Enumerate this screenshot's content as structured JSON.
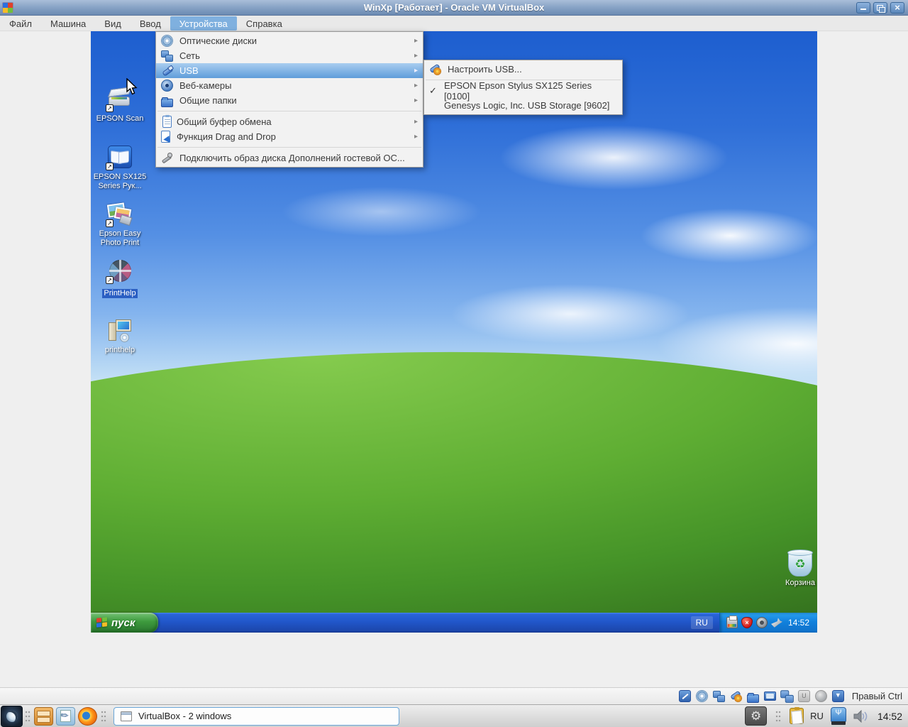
{
  "titlebar": {
    "title": "WinXp [Работает] - Oracle VM VirtualBox"
  },
  "menubar": {
    "items": [
      "Файл",
      "Машина",
      "Вид",
      "Ввод",
      "Устройства",
      "Справка"
    ],
    "active": "Устройства"
  },
  "devices_menu": {
    "items": [
      {
        "label": "Оптические диски",
        "icon": "optical-disc-icon"
      },
      {
        "label": "Сеть",
        "icon": "network-icon"
      },
      {
        "label": "USB",
        "icon": "usb-icon",
        "highlighted": true
      },
      {
        "label": "Веб-камеры",
        "icon": "webcam-icon"
      },
      {
        "label": "Общие папки",
        "icon": "shared-folders-icon"
      },
      {
        "label": "Общий буфер обмена",
        "icon": "clipboard-icon"
      },
      {
        "label": "Функция Drag and Drop",
        "icon": "drag-and-drop-icon"
      },
      {
        "label": "Подключить образ диска Дополнений гостевой ОС...",
        "icon": "guest-additions-icon"
      }
    ]
  },
  "usb_submenu": {
    "settings_label": "Настроить USB...",
    "devices": [
      {
        "label": "EPSON Epson Stylus SX125 Series [0100]",
        "checked": true,
        "check_glyph": "✓"
      },
      {
        "label": "Genesys Logic, Inc. USB Storage [9602]",
        "checked": false,
        "check_glyph": ""
      }
    ]
  },
  "desktop": {
    "icons": [
      {
        "label": "EPSON Scan",
        "icon": "epson-scan-icon"
      },
      {
        "label": "EPSON SX125 Series Рук...",
        "icon": "epson-manual-icon"
      },
      {
        "label": "Epson Easy Photo Print",
        "icon": "epson-photo-print-icon"
      },
      {
        "label": "PrintHelp",
        "icon": "printhelp-wheel-icon",
        "selected": true
      },
      {
        "label": "printhelp",
        "icon": "printhelp-setup-icon"
      }
    ],
    "recycle_bin_label": "Корзина"
  },
  "guest_taskbar": {
    "start_label": "пуск",
    "language": "RU",
    "clock": "14:52",
    "tray_icons": [
      "printer-status-icon",
      "security-alert-shield-icon",
      "speaker-icon",
      "epson-monitor-icon"
    ]
  },
  "vbox_statusbar": {
    "host_key_label": "Правый Ctrl",
    "icons": [
      "hard-disks-icon",
      "optical-drives-icon",
      "network-adapters-icon",
      "usb-devices-icon",
      "shared-folders-icon",
      "display-icon",
      "recording-icon",
      "features-icon",
      "mouse-integration-icon",
      "statusbar-menu-icon"
    ]
  },
  "host_taskbar": {
    "task_button_label": "VirtualBox - 2 windows",
    "language": "RU",
    "clock": "14:52",
    "launcher_icons": [
      "app-menu-icon",
      "file-manager-icon",
      "text-editor-icon",
      "firefox-icon"
    ],
    "tray_icons": [
      "settings-gear-icon",
      "clipboard-manager-icon",
      "usb-drive-icon",
      "volume-icon"
    ]
  }
}
